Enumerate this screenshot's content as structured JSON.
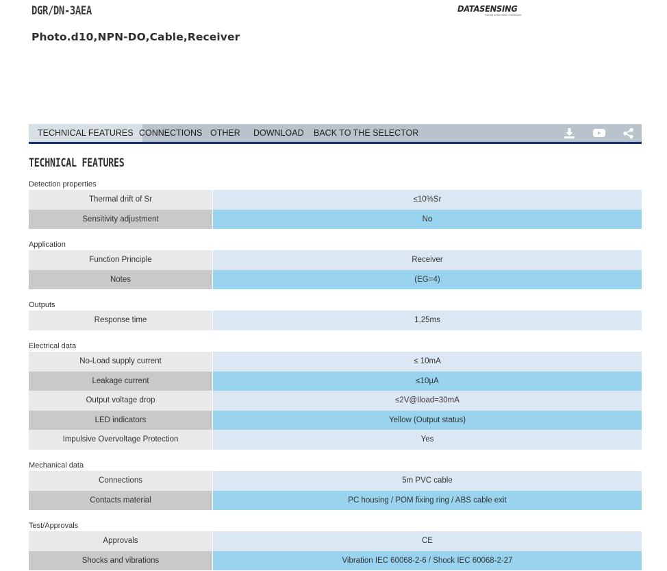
{
  "header": {
    "product_code": "DGR/DN-3AEA",
    "product_description": "Photo.d10,NPN-DO,Cable,Receiver",
    "logo_text": "DATASENSING",
    "logo_tagline": "tracing automation challenges"
  },
  "tabs": [
    {
      "label": "TECHNICAL FEATURES",
      "active": true
    },
    {
      "label": "CONNECTIONS",
      "active": false
    },
    {
      "label": "OTHER",
      "active": false
    },
    {
      "label": "DOWNLOAD",
      "active": false
    },
    {
      "label": "BACK TO THE SELECTOR",
      "active": false
    }
  ],
  "toolbar_icons": [
    "download-icon",
    "youtube-icon",
    "share-icon"
  ],
  "section_title": "TECHNICAL FEATURES",
  "groups": [
    {
      "title": "Detection properties",
      "rows": [
        {
          "key": "Thermal drift of Sr",
          "value": "≤10%Sr"
        },
        {
          "key": "Sensitivity adjustment",
          "value": "No"
        }
      ]
    },
    {
      "title": "Application",
      "rows": [
        {
          "key": "Function Principle",
          "value": "Receiver"
        },
        {
          "key": "Notes",
          "value": "(EG=4)"
        }
      ]
    },
    {
      "title": "Outputs",
      "rows": [
        {
          "key": "Response time",
          "value": "1,25ms"
        }
      ]
    },
    {
      "title": "Electrical data",
      "rows": [
        {
          "key": "No-Load supply current",
          "value": "≤ 10mA"
        },
        {
          "key": "Leakage current",
          "value": "≤10µA"
        },
        {
          "key": "Output voltage drop",
          "value": "≤2V@Iload=30mA"
        },
        {
          "key": "LED indicators",
          "value": "Yellow (Output status)"
        },
        {
          "key": "Impulsive Overvoltage Protection",
          "value": "Yes"
        }
      ]
    },
    {
      "title": "Mechanical data",
      "rows": [
        {
          "key": "Connections",
          "value": "5m PVC cable"
        },
        {
          "key": "Contacts material",
          "value": "PC housing / POM fixing ring / ABS cable exit"
        }
      ]
    },
    {
      "title": "Test/Approvals",
      "rows": [
        {
          "key": "Approvals",
          "value": "CE"
        },
        {
          "key": "Shocks and vibrations",
          "value": "Vibration IEC 60068-2-6 / Shock IEC 60068-2-27"
        }
      ]
    }
  ],
  "colors": {
    "tabbar_bg": "#b9c3cb",
    "tab_underline": "#15336b",
    "row_value_light": "#dbe8f4",
    "row_value_dark": "#99d3ee"
  }
}
